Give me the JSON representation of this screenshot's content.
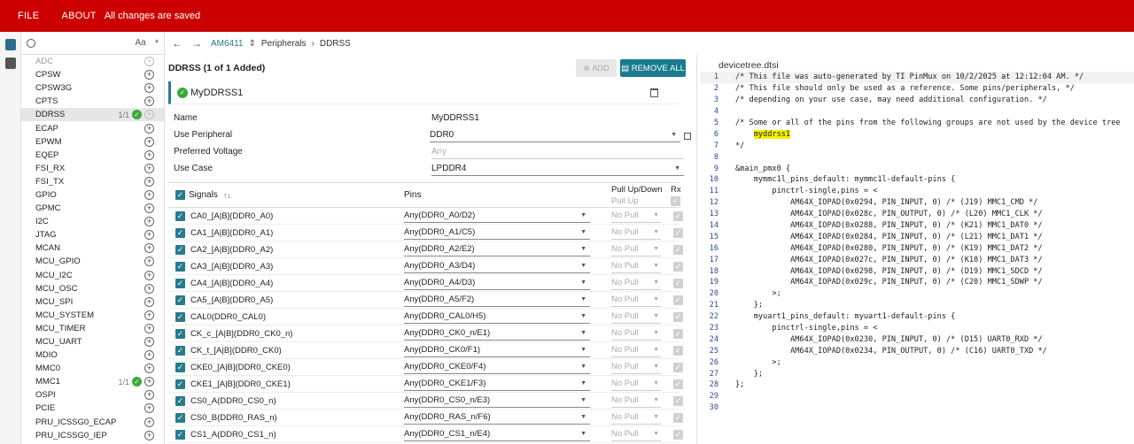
{
  "topbar": {
    "file": "FILE",
    "about": "ABOUT",
    "status": "All changes are saved",
    "color": "#cc0000"
  },
  "search": {
    "aa": "Aa",
    "star": "*"
  },
  "sidebar": {
    "items": [
      {
        "label": "ADC",
        "dim": true,
        "count": "",
        "ok": false
      },
      {
        "label": "CPSW",
        "count": "",
        "ok": false
      },
      {
        "label": "CPSW3G",
        "count": "",
        "ok": false
      },
      {
        "label": "CPTS",
        "count": "",
        "ok": false
      },
      {
        "label": "DDRSS",
        "count": "1/1",
        "ok": true,
        "selected": true
      },
      {
        "label": "ECAP",
        "count": "",
        "ok": false
      },
      {
        "label": "EPWM",
        "count": "",
        "ok": false
      },
      {
        "label": "EQEP",
        "count": "",
        "ok": false
      },
      {
        "label": "FSI_RX",
        "count": "",
        "ok": false
      },
      {
        "label": "FSI_TX",
        "count": "",
        "ok": false
      },
      {
        "label": "GPIO",
        "count": "",
        "ok": false
      },
      {
        "label": "GPMC",
        "count": "",
        "ok": false
      },
      {
        "label": "I2C",
        "count": "",
        "ok": false
      },
      {
        "label": "JTAG",
        "count": "",
        "ok": false
      },
      {
        "label": "MCAN",
        "count": "",
        "ok": false
      },
      {
        "label": "MCU_GPIO",
        "count": "",
        "ok": false
      },
      {
        "label": "MCU_I2C",
        "count": "",
        "ok": false
      },
      {
        "label": "MCU_OSC",
        "count": "",
        "ok": false
      },
      {
        "label": "MCU_SPI",
        "count": "",
        "ok": false
      },
      {
        "label": "MCU_SYSTEM",
        "count": "",
        "ok": false
      },
      {
        "label": "MCU_TIMER",
        "count": "",
        "ok": false
      },
      {
        "label": "MCU_UART",
        "count": "",
        "ok": false
      },
      {
        "label": "MDIO",
        "count": "",
        "ok": false
      },
      {
        "label": "MMC0",
        "count": "",
        "ok": false
      },
      {
        "label": "MMC1",
        "count": "1/1",
        "ok": true
      },
      {
        "label": "OSPI",
        "count": "",
        "ok": false
      },
      {
        "label": "PCIE",
        "count": "",
        "ok": false
      },
      {
        "label": "PRU_ICSSG0_ECAP",
        "count": "",
        "ok": false
      },
      {
        "label": "PRU_ICSSG0_IEP",
        "count": "",
        "ok": false
      }
    ]
  },
  "breadcrumb": {
    "device": "AM6411",
    "path1": "Peripherals",
    "path2": "DDRSS"
  },
  "main": {
    "title": "DDRSS (1 of 1 Added)",
    "add_label": "ADD",
    "remove_all_label": "REMOVE ALL",
    "instance": "MyDDRSS1",
    "props": [
      {
        "label": "Name",
        "value": "MyDDRSS1",
        "style": "plain"
      },
      {
        "label": "Use Peripheral",
        "value": "DDR0",
        "style": "dropdown",
        "lock": true
      },
      {
        "label": "Preferred Voltage",
        "value": "Any",
        "style": "dim"
      },
      {
        "label": "Use Case",
        "value": "LPDDR4",
        "style": "dropdown"
      }
    ],
    "signals_header": "Signals",
    "pins_header": "Pins",
    "pull_header": "Pull Up/Down",
    "pull_sub": "Pull Up",
    "rx_header": "Rx",
    "signals": [
      {
        "name": "CA0_[A|B](DDR0_A0)",
        "pin": "Any(DDR0_A0/D2)",
        "pull": "No Pull"
      },
      {
        "name": "CA1_[A|B](DDR0_A1)",
        "pin": "Any(DDR0_A1/C5)",
        "pull": "No Pull"
      },
      {
        "name": "CA2_[A|B](DDR0_A2)",
        "pin": "Any(DDR0_A2/E2)",
        "pull": "No Pull"
      },
      {
        "name": "CA3_[A|B](DDR0_A3)",
        "pin": "Any(DDR0_A3/D4)",
        "pull": "No Pull"
      },
      {
        "name": "CA4_[A|B](DDR0_A4)",
        "pin": "Any(DDR0_A4/D3)",
        "pull": "No Pull"
      },
      {
        "name": "CA5_[A|B](DDR0_A5)",
        "pin": "Any(DDR0_A5/F2)",
        "pull": "No Pull"
      },
      {
        "name": "CAL0(DDR0_CAL0)",
        "pin": "Any(DDR0_CAL0/H5)",
        "pull": "No Pull"
      },
      {
        "name": "CK_c_[A|B](DDR0_CK0_n)",
        "pin": "Any(DDR0_CK0_n/E1)",
        "pull": "No Pull"
      },
      {
        "name": "CK_t_[A|B](DDR0_CK0)",
        "pin": "Any(DDR0_CK0/F1)",
        "pull": "No Pull"
      },
      {
        "name": "CKE0_[A|B](DDR0_CKE0)",
        "pin": "Any(DDR0_CKE0/F4)",
        "pull": "No Pull"
      },
      {
        "name": "CKE1_[A|B](DDR0_CKE1)",
        "pin": "Any(DDR0_CKE1/F3)",
        "pull": "No Pull"
      },
      {
        "name": "CS0_A(DDR0_CS0_n)",
        "pin": "Any(DDR0_CS0_n/E3)",
        "pull": "No Pull"
      },
      {
        "name": "CS0_B(DDR0_RAS_n)",
        "pin": "Any(DDR0_RAS_n/F6)",
        "pull": "No Pull"
      },
      {
        "name": "CS1_A(DDR0_CS1_n)",
        "pin": "Any(DDR0_CS1_n/E4)",
        "pull": "No Pull"
      }
    ]
  },
  "code": {
    "filename": "devicetree.dtsi",
    "lines": [
      "/* This file was auto-generated by TI PinMux on 10/2/2025 at 12:12:04 AM. */",
      "/* This file should only be used as a reference. Some pins/peripherals, */",
      "/* depending on your use case, may need additional configuration. */",
      "",
      "/* Some or all of the pins from the following groups are not used by the device tree",
      "    myddrss1",
      "*/",
      "",
      "&main_pmx0 {",
      "    mymmc1l_pins_default: mymmc1l-default-pins {",
      "        pinctrl-single,pins = <",
      "            AM64X_IOPAD(0x0294, PIN_INPUT, 0) /* (J19) MMC1_CMD */",
      "            AM64X_IOPAD(0x028c, PIN_OUTPUT, 0) /* (L20) MMC1_CLK */",
      "            AM64X_IOPAD(0x0288, PIN_INPUT, 0) /* (K21) MMC1_DAT0 */",
      "            AM64X_IOPAD(0x0284, PIN_INPUT, 0) /* (L21) MMC1_DAT1 */",
      "            AM64X_IOPAD(0x0280, PIN_INPUT, 0) /* (K19) MMC1_DAT2 */",
      "            AM64X_IOPAD(0x027c, PIN_INPUT, 0) /* (K18) MMC1_DAT3 */",
      "            AM64X_IOPAD(0x0298, PIN_INPUT, 0) /* (D19) MMC1_SDCD */",
      "            AM64X_IOPAD(0x029c, PIN_INPUT, 0) /* (C20) MMC1_SDWP */",
      "        >;",
      "    };",
      "    myuart1_pins_default: myuart1-default-pins {",
      "        pinctrl-single,pins = <",
      "            AM64X_IOPAD(0x0230, PIN_INPUT, 0) /* (D15) UART0_RXD */",
      "            AM64X_IOPAD(0x0234, PIN_OUTPUT, 0) /* (C16) UART0_TXD */",
      "        >;",
      "    };",
      "};",
      "",
      ""
    ],
    "highlight_line": 6,
    "current_line": 1
  }
}
